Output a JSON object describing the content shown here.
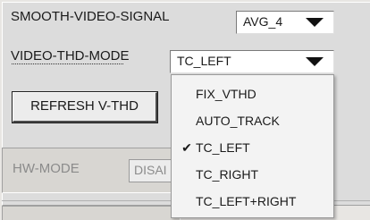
{
  "smooth_video_signal": {
    "label": "SMOOTH-VIDEO-SIGNAL",
    "value": "AVG_4"
  },
  "video_thd_mode": {
    "label": "VIDEO-THD-MODE",
    "value": "TC_LEFT"
  },
  "refresh_button": {
    "label": "REFRESH V-THD"
  },
  "hw_mode": {
    "label": "HW-MODE",
    "value": "DISAI"
  },
  "dropdown": {
    "items": [
      {
        "label": "FIX_VTHD",
        "checked": false
      },
      {
        "label": "AUTO_TRACK",
        "checked": false
      },
      {
        "label": "TC_LEFT",
        "checked": true
      },
      {
        "label": "TC_RIGHT",
        "checked": false
      },
      {
        "label": "TC_LEFT+RIGHT",
        "checked": false
      }
    ],
    "check_glyph": "✔"
  },
  "icons": {
    "select_arrow": "triangle-down-icon",
    "check": "check-icon"
  }
}
